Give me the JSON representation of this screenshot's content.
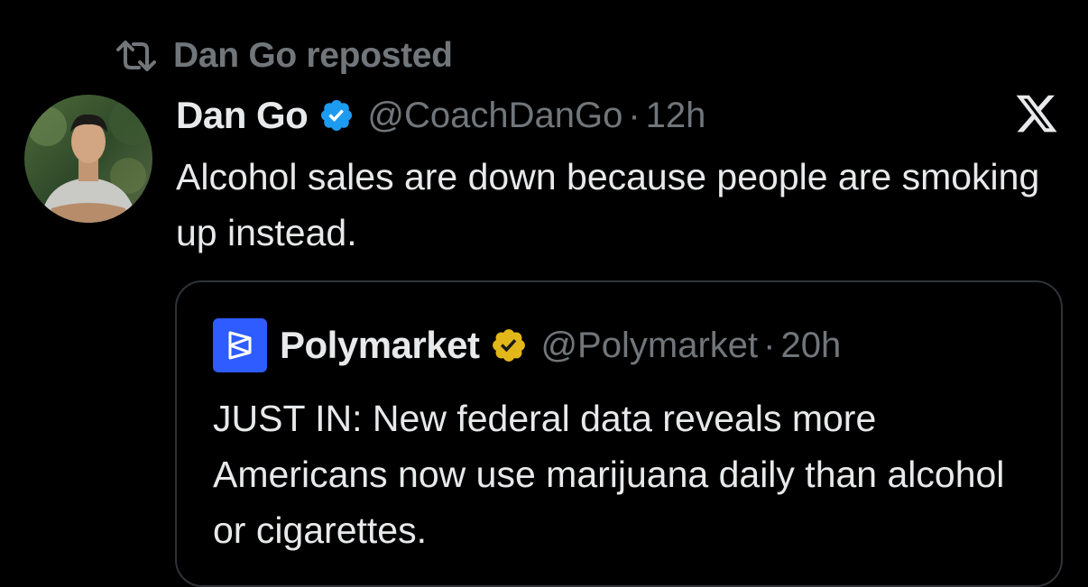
{
  "repost": {
    "icon": "repost-icon",
    "text": "Dan Go reposted"
  },
  "tweet": {
    "author_name": "Dan Go",
    "verified_badge": "blue-verified-badge-icon",
    "handle": "@CoachDanGo",
    "separator": "·",
    "time": "12h",
    "text": "Alcohol sales are down because people are smoking up instead."
  },
  "brand": {
    "logo": "x-logo-icon"
  },
  "quote": {
    "logo": "polymarket-logo-icon",
    "author_name": "Polymarket",
    "verified_badge": "gold-verified-badge-icon",
    "handle": "@Polymarket",
    "separator": "·",
    "time": "20h",
    "text": "JUST IN: New federal data reveals more Americans now use marijuana daily than alcohol or cigarettes."
  },
  "colors": {
    "background": "#000000",
    "primary_text": "#e7e9ea",
    "secondary_text": "#71767b",
    "blue_badge": "#1d9bf0",
    "gold_badge": "#e2b719",
    "polymarket_blue": "#2e5cff",
    "card_border": "#2f3336"
  }
}
